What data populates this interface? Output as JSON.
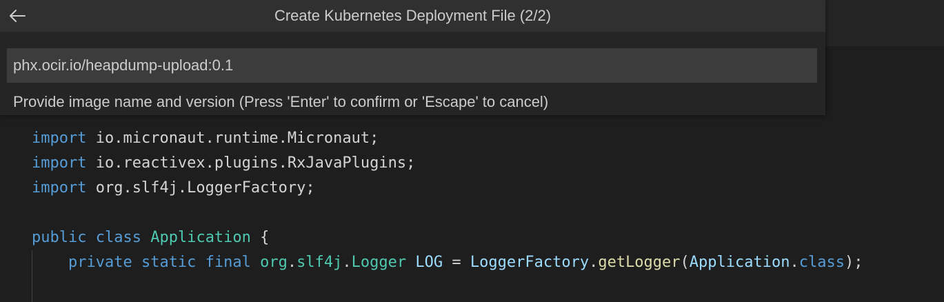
{
  "quick_input": {
    "title": "Create Kubernetes Deployment File (2/2)",
    "input_value": "phx.ocir.io/heapdump-upload:0.1",
    "message": "Provide image name and version (Press 'Enter' to confirm or 'Escape' to cancel)",
    "back_icon": "arrow-left-icon"
  },
  "editor": {
    "lines": {
      "l1": {
        "kw": "import",
        "rest": " io.micronaut.runtime.Micronaut;"
      },
      "l2": {
        "kw": "import",
        "rest": " io.reactivex.plugins.RxJavaPlugins;"
      },
      "l3": {
        "kw": "import",
        "rest": " org.slf4j.LoggerFactory;"
      },
      "l5": {
        "kw1": "public",
        "kw2": "class",
        "cls": "Application",
        "rest": " {"
      },
      "l6": {
        "indent": "    ",
        "kw1": "private",
        "kw2": "static",
        "kw3": "final",
        "pkg1": "org",
        "dot1": ".",
        "pkg2": "slf4j",
        "dot2": ".",
        "type": "Logger",
        "var": "LOG",
        "eq": " = ",
        "cls": "LoggerFactory",
        "dot3": ".",
        "fn": "getLogger",
        "open": "(",
        "arg": "Application",
        "dot4": ".",
        "argkw": "class",
        "close": ");"
      }
    }
  },
  "colors": {
    "keyword": "#569cd6",
    "class": "#4ec9b0",
    "variable": "#9cdcfe",
    "function": "#dcdcaa",
    "text": "#d4d4d4"
  }
}
